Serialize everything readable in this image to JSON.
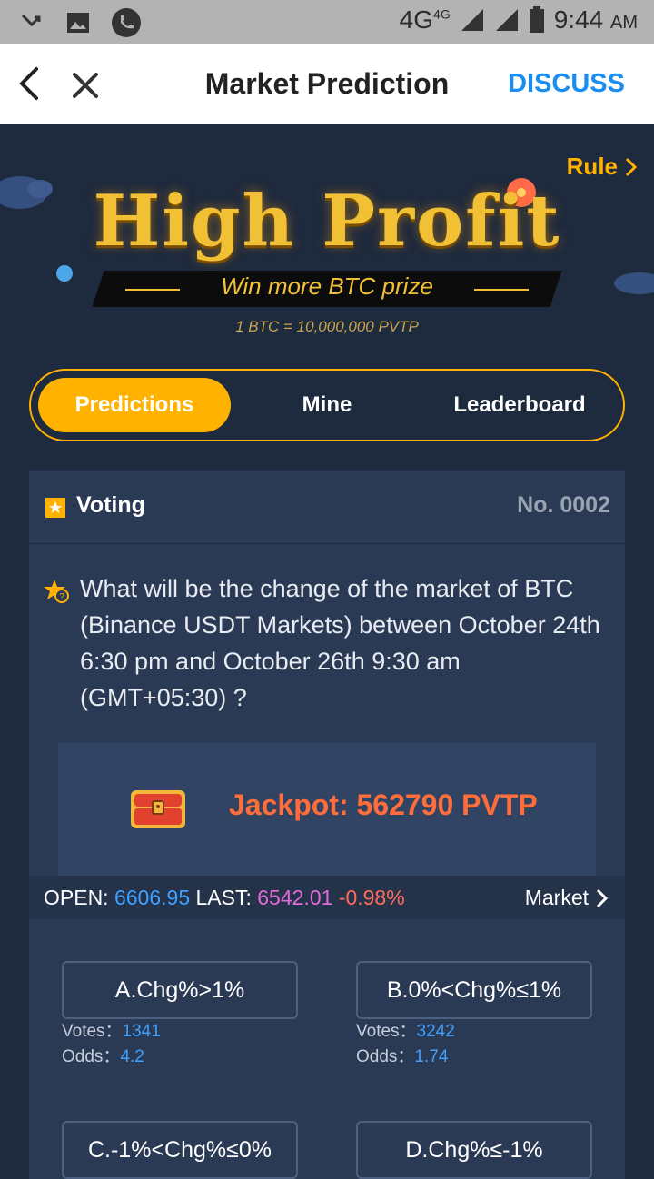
{
  "status_bar": {
    "network": "4G",
    "network_sup": "4G",
    "time": "9:44",
    "ampm": "AM"
  },
  "header": {
    "title": "Market Prediction",
    "discuss_label": "DISCUSS"
  },
  "banner": {
    "rule_label": "Rule",
    "headline": "High Profit",
    "subtitle": "Win more BTC prize",
    "rate": "1 BTC = 10,000,000 PVTP"
  },
  "tabs": [
    {
      "label": "Predictions",
      "active": true
    },
    {
      "label": "Mine",
      "active": false
    },
    {
      "label": "Leaderboard",
      "active": false
    }
  ],
  "card": {
    "title": "Voting",
    "number": "No. 0002",
    "question": "What will be the change of the market of BTC (Binance USDT Markets) between October 24th 6:30 pm and October 26th 9:30 am (GMT+05:30) ?",
    "jackpot": "Jackpot: 562790 PVTP",
    "market": {
      "open_label": "OPEN:",
      "open_value": "6606.95",
      "last_label": "LAST:",
      "last_value": "6542.01",
      "change": "-0.98%",
      "market_link": "Market"
    },
    "options": [
      {
        "label": "A.Chg%>1%",
        "votes_label": "Votes：",
        "votes": "1341",
        "odds_label": "Odds：",
        "odds": "4.2"
      },
      {
        "label": "B.0%<Chg%≤1%",
        "votes_label": "Votes：",
        "votes": "3242",
        "odds_label": "Odds：",
        "odds": "1.74"
      },
      {
        "label": "C.-1%<Chg%≤0%"
      },
      {
        "label": "D.Chg%≤-1%"
      }
    ]
  },
  "colors": {
    "accent": "#ffb300",
    "link": "#1a8ef0",
    "jackpot": "#ff6d3a",
    "open": "#3ea0ff",
    "last": "#e26bd6",
    "change": "#ff6b5b"
  }
}
